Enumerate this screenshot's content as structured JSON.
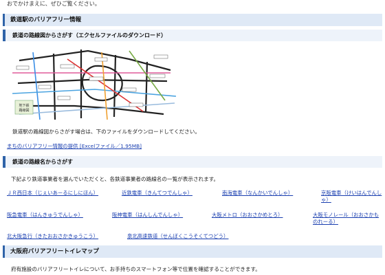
{
  "intro_text": "おでかけまえに、ぜひご覧ください。",
  "section1": {
    "title": "鉄道駅のバリアフリー情報"
  },
  "sub1": {
    "title": "鉄道の路線図からさがす（エクセルファイルのダウンロード）",
    "description": "鉄道駅の路線図からさがす場合は、下のファイルをダウンロードしてください。",
    "download_link": "まちのバリアフリー情報の提供 [Excelファイル／1.95MB]",
    "map_labels": [
      "地下鉄",
      "路線図"
    ]
  },
  "sub2": {
    "title": "鉄道の路線名からさがす",
    "description": "下記より鉄道事業者を選んでいただくと、各鉄道事業者の路線名の一覧が表示されます。",
    "operators": [
      "ＪＲ西日本（じぇいあーるにしにほん）",
      "近鉄電車（きんてつでんしゃ）",
      "南海電車（なんかいでんしゃ）",
      "京阪電車（けいはんでんしゃ）",
      "阪急電車（はんきゅうでんしゃ）",
      "阪神電車（はんしんでんしゃ）",
      "大阪メトロ（おおさかめとろ）",
      "大阪モノレール（おおさかものれーる）",
      "北大阪急行（きたおおさかきゅうこう）",
      "泉北高速鉄道（せんぼくこうそくてつどう）"
    ]
  },
  "section2": {
    "title": "大阪府バリアフリートイレマップ",
    "description": "府有施設のバリアフリートイレについて、お手持ちのスマートフォン等で位置を確認することができます。"
  },
  "colors": {
    "accent": "#2f63a8",
    "link": "#1a3fb0"
  }
}
